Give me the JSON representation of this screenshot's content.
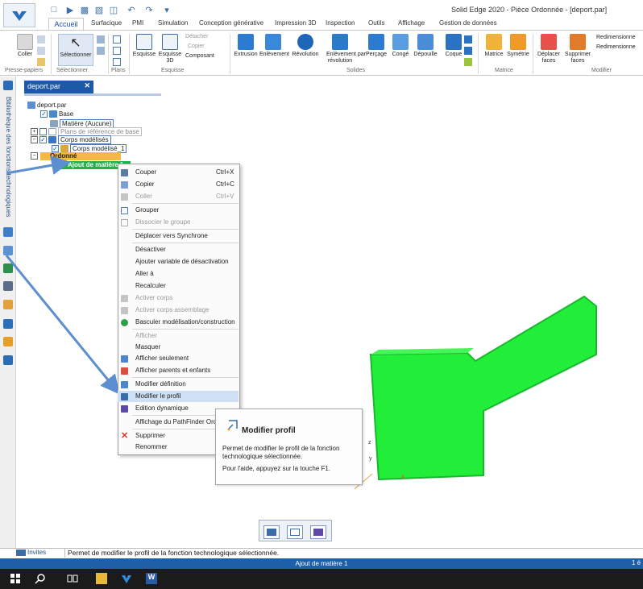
{
  "window": {
    "title": "Solid Edge 2020 - Pièce Ordonnée - [deport.par]"
  },
  "tabs": [
    "Accueil",
    "Surfacique",
    "PMI",
    "Simulation",
    "Conception générative",
    "Impression 3D",
    "Inspection",
    "Outils",
    "Affichage",
    "Gestion de données"
  ],
  "ribbon": {
    "presse_papiers": {
      "coller": "Coller",
      "label": "Presse-papiers"
    },
    "selectionner": {
      "button": "Sélectionner",
      "label": "Sélectionner"
    },
    "plans": {
      "label": "Plans"
    },
    "esquisse": {
      "esquisse": "Esquisse",
      "esquisse3d_line1": "Esquisse",
      "esquisse3d_line2": "3D",
      "detacher": "Détacher",
      "copier": "Copier",
      "composant": "Composant",
      "label": "Esquisse"
    },
    "solides": {
      "extrusion": "Extrusion",
      "enlevement": "Enlèvement",
      "revolution": "Révolution",
      "enlevement_rev_line1": "Enlèvement par",
      "enlevement_rev_line2": "révolution",
      "percage": "Perçage",
      "conge": "Congé",
      "depouille": "Dépouille",
      "coque": "Coque",
      "label": "Solides"
    },
    "matrice": {
      "matrice": "Matrice",
      "symetrie": "Symétrie",
      "label": "Matrice"
    },
    "modifier": {
      "deplacer_line1": "Déplacer",
      "deplacer_line2": "faces",
      "supprimer_line1": "Supprimer",
      "supprimer_line2": "faces",
      "redim1": "Redimensionne",
      "redim2": "Redimensionne",
      "label": "Modifier"
    }
  },
  "sidebar": {
    "vertical_label": "Bibliothèque des fonctions technologiques"
  },
  "document_tab": {
    "label": "deport.par"
  },
  "tree": {
    "root": "deport.par",
    "base": "Base",
    "matiere": "Matière (Aucune)",
    "plans": "Plans de référence de base",
    "corps_modelises": "Corps modélisés",
    "corps_modelise_1": "Corps modélisé_1",
    "ordonne": "Ordonné",
    "ajout": "Ajout de matière 1"
  },
  "context_menu": {
    "couper": "Couper",
    "couper_sc": "Ctrl+X",
    "copier": "Copier",
    "copier_sc": "Ctrl+C",
    "coller": "Coller",
    "coller_sc": "Ctrl+V",
    "grouper": "Grouper",
    "dissocier": "Dissocier le groupe",
    "deplacer_sync": "Déplacer vers Synchrone",
    "desactiver": "Désactiver",
    "ajouter_var": "Ajouter variable de désactivation",
    "aller_a": "Aller à",
    "recalculer": "Recalculer",
    "activer_corps": "Activer corps",
    "activer_corps_assemblage": "Activer corps assemblage",
    "basculer": "Basculer modélisation/construction",
    "afficher": "Afficher",
    "masquer": "Masquer",
    "afficher_seulement": "Afficher seulement",
    "afficher_parents": "Afficher parents et enfants",
    "modifier_definition": "Modifier définition",
    "modifier_profil": "Modifier le profil",
    "edition_dynamique": "Edition dynamique",
    "affichage_pathfinder": "Affichage du PathFinder Ordonné",
    "supprimer": "Supprimer",
    "renommer": "Renommer"
  },
  "tooltip": {
    "title": "Modifier profil",
    "body": "Permet de modifier le profil de la fonction technologique sélectionnée.",
    "help": "Pour l'aide, appuyez sur la touche F1."
  },
  "prompt": {
    "label": "Invites",
    "text": "Permet de modifier le profil de la fonction technologique sélectionnée."
  },
  "status": {
    "text": "Ajout de matière 1",
    "right": "1 é"
  },
  "colors": {
    "accent": "#1f5fa8",
    "model": "#22ee3a",
    "ordonne": "#f4b942",
    "selection": "#22b14c"
  }
}
